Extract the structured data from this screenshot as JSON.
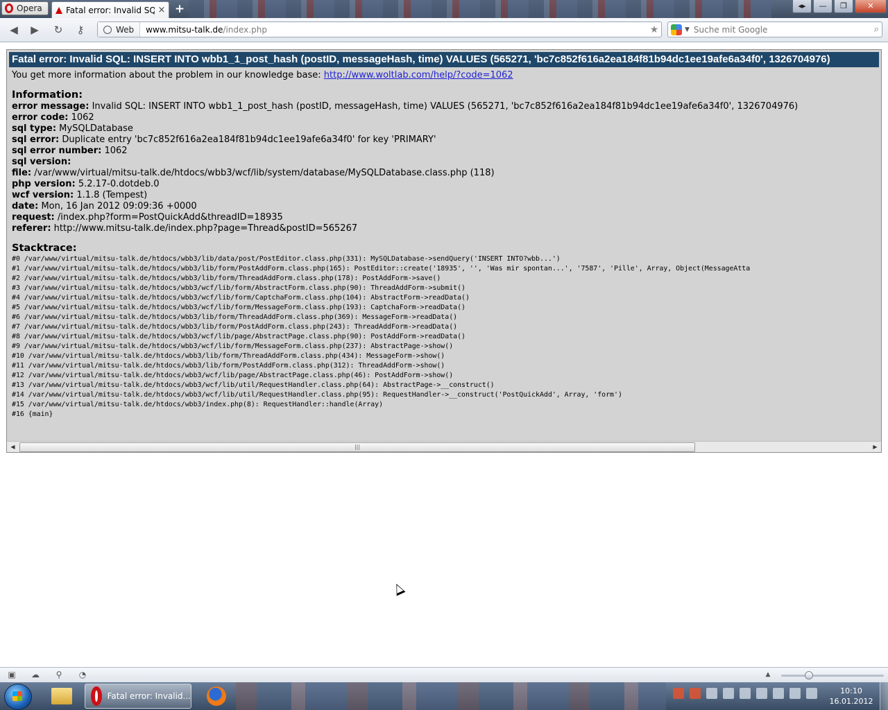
{
  "browser": {
    "menu_label": "Opera",
    "tab_title": "Fatal error: Invalid SQL:...",
    "new_tab_label": "+",
    "address_mode": "Web",
    "url_host": "www.mitsu-talk.de",
    "url_path": "/index.php",
    "search_placeholder": "Suche mit Google"
  },
  "error": {
    "heading": "Fatal error: Invalid SQL: INSERT INTO wbb1_1_post_hash (postID, messageHash, time) VALUES (565271, 'bc7c852f616a2ea184f81b94dc1ee19afe6a34f0', 1326704976)",
    "kb_text": "You get more information about the problem in our knowledge base: ",
    "kb_link": "http://www.woltlab.com/help/?code=1062",
    "info_title": "Information:",
    "info": [
      {
        "label": "error message:",
        "value": " Invalid SQL: INSERT INTO wbb1_1_post_hash (postID, messageHash, time) VALUES (565271, 'bc7c852f616a2ea184f81b94dc1ee19afe6a34f0', 1326704976)"
      },
      {
        "label": "error code:",
        "value": " 1062"
      },
      {
        "label": "sql type:",
        "value": " MySQLDatabase"
      },
      {
        "label": "sql error:",
        "value": " Duplicate entry 'bc7c852f616a2ea184f81b94dc1ee19afe6a34f0' for key 'PRIMARY'"
      },
      {
        "label": "sql error number:",
        "value": " 1062"
      },
      {
        "label": "sql version:",
        "value": ""
      },
      {
        "label": "file:",
        "value": " /var/www/virtual/mitsu-talk.de/htdocs/wbb3/wcf/lib/system/database/MySQLDatabase.class.php (118)"
      },
      {
        "label": "php version:",
        "value": " 5.2.17-0.dotdeb.0"
      },
      {
        "label": "wcf version:",
        "value": " 1.1.8 (Tempest)"
      },
      {
        "label": "date:",
        "value": " Mon, 16 Jan 2012 09:09:36 +0000"
      },
      {
        "label": "request:",
        "value": " /index.php?form=PostQuickAdd&threadID=18935"
      },
      {
        "label": "referer:",
        "value": " http://www.mitsu-talk.de/index.php?page=Thread&postID=565267"
      }
    ],
    "stack_title": "Stacktrace:",
    "stack": [
      "#0 /var/www/virtual/mitsu-talk.de/htdocs/wbb3/lib/data/post/PostEditor.class.php(331): MySQLDatabase->sendQuery('INSERT INTO?wbb...')",
      "#1 /var/www/virtual/mitsu-talk.de/htdocs/wbb3/lib/form/PostAddForm.class.php(165): PostEditor::create('18935', '', 'Was mir spontan...', '7587', 'Pille', Array, Object(MessageAtta",
      "#2 /var/www/virtual/mitsu-talk.de/htdocs/wbb3/lib/form/ThreadAddForm.class.php(178): PostAddForm->save()",
      "#3 /var/www/virtual/mitsu-talk.de/htdocs/wbb3/wcf/lib/form/AbstractForm.class.php(90): ThreadAddForm->submit()",
      "#4 /var/www/virtual/mitsu-talk.de/htdocs/wbb3/wcf/lib/form/CaptchaForm.class.php(104): AbstractForm->readData()",
      "#5 /var/www/virtual/mitsu-talk.de/htdocs/wbb3/wcf/lib/form/MessageForm.class.php(193): CaptchaForm->readData()",
      "#6 /var/www/virtual/mitsu-talk.de/htdocs/wbb3/lib/form/ThreadAddForm.class.php(369): MessageForm->readData()",
      "#7 /var/www/virtual/mitsu-talk.de/htdocs/wbb3/lib/form/PostAddForm.class.php(243): ThreadAddForm->readData()",
      "#8 /var/www/virtual/mitsu-talk.de/htdocs/wbb3/wcf/lib/page/AbstractPage.class.php(90): PostAddForm->readData()",
      "#9 /var/www/virtual/mitsu-talk.de/htdocs/wbb3/wcf/lib/form/MessageForm.class.php(237): AbstractPage->show()",
      "#10 /var/www/virtual/mitsu-talk.de/htdocs/wbb3/lib/form/ThreadAddForm.class.php(434): MessageForm->show()",
      "#11 /var/www/virtual/mitsu-talk.de/htdocs/wbb3/lib/form/PostAddForm.class.php(312): ThreadAddForm->show()",
      "#12 /var/www/virtual/mitsu-talk.de/htdocs/wbb3/wcf/lib/page/AbstractPage.class.php(46): PostAddForm->show()",
      "#13 /var/www/virtual/mitsu-talk.de/htdocs/wbb3/wcf/lib/util/RequestHandler.class.php(64): AbstractPage->__construct()",
      "#14 /var/www/virtual/mitsu-talk.de/htdocs/wbb3/wcf/lib/util/RequestHandler.class.php(95): RequestHandler->__construct('PostQuickAdd', Array, 'form')",
      "#15 /var/www/virtual/mitsu-talk.de/htdocs/wbb3/index.php(8): RequestHandler::handle(Array)",
      "#16 {main}"
    ]
  },
  "taskbar": {
    "opera_window_label": "Fatal error: Invalid...",
    "clock_time": "10:10",
    "clock_date": "16.01.2012"
  },
  "icons": [
    "opera-logo-icon",
    "close-icon",
    "back-icon",
    "forward-icon",
    "reload-icon",
    "key-icon",
    "globe-icon",
    "star-icon",
    "google-icon",
    "search-icon",
    "panel-icon",
    "cloud-icon",
    "share-icon",
    "speed-icon",
    "zoom-icon",
    "windows-start-icon",
    "folder-icon",
    "firefox-icon"
  ]
}
